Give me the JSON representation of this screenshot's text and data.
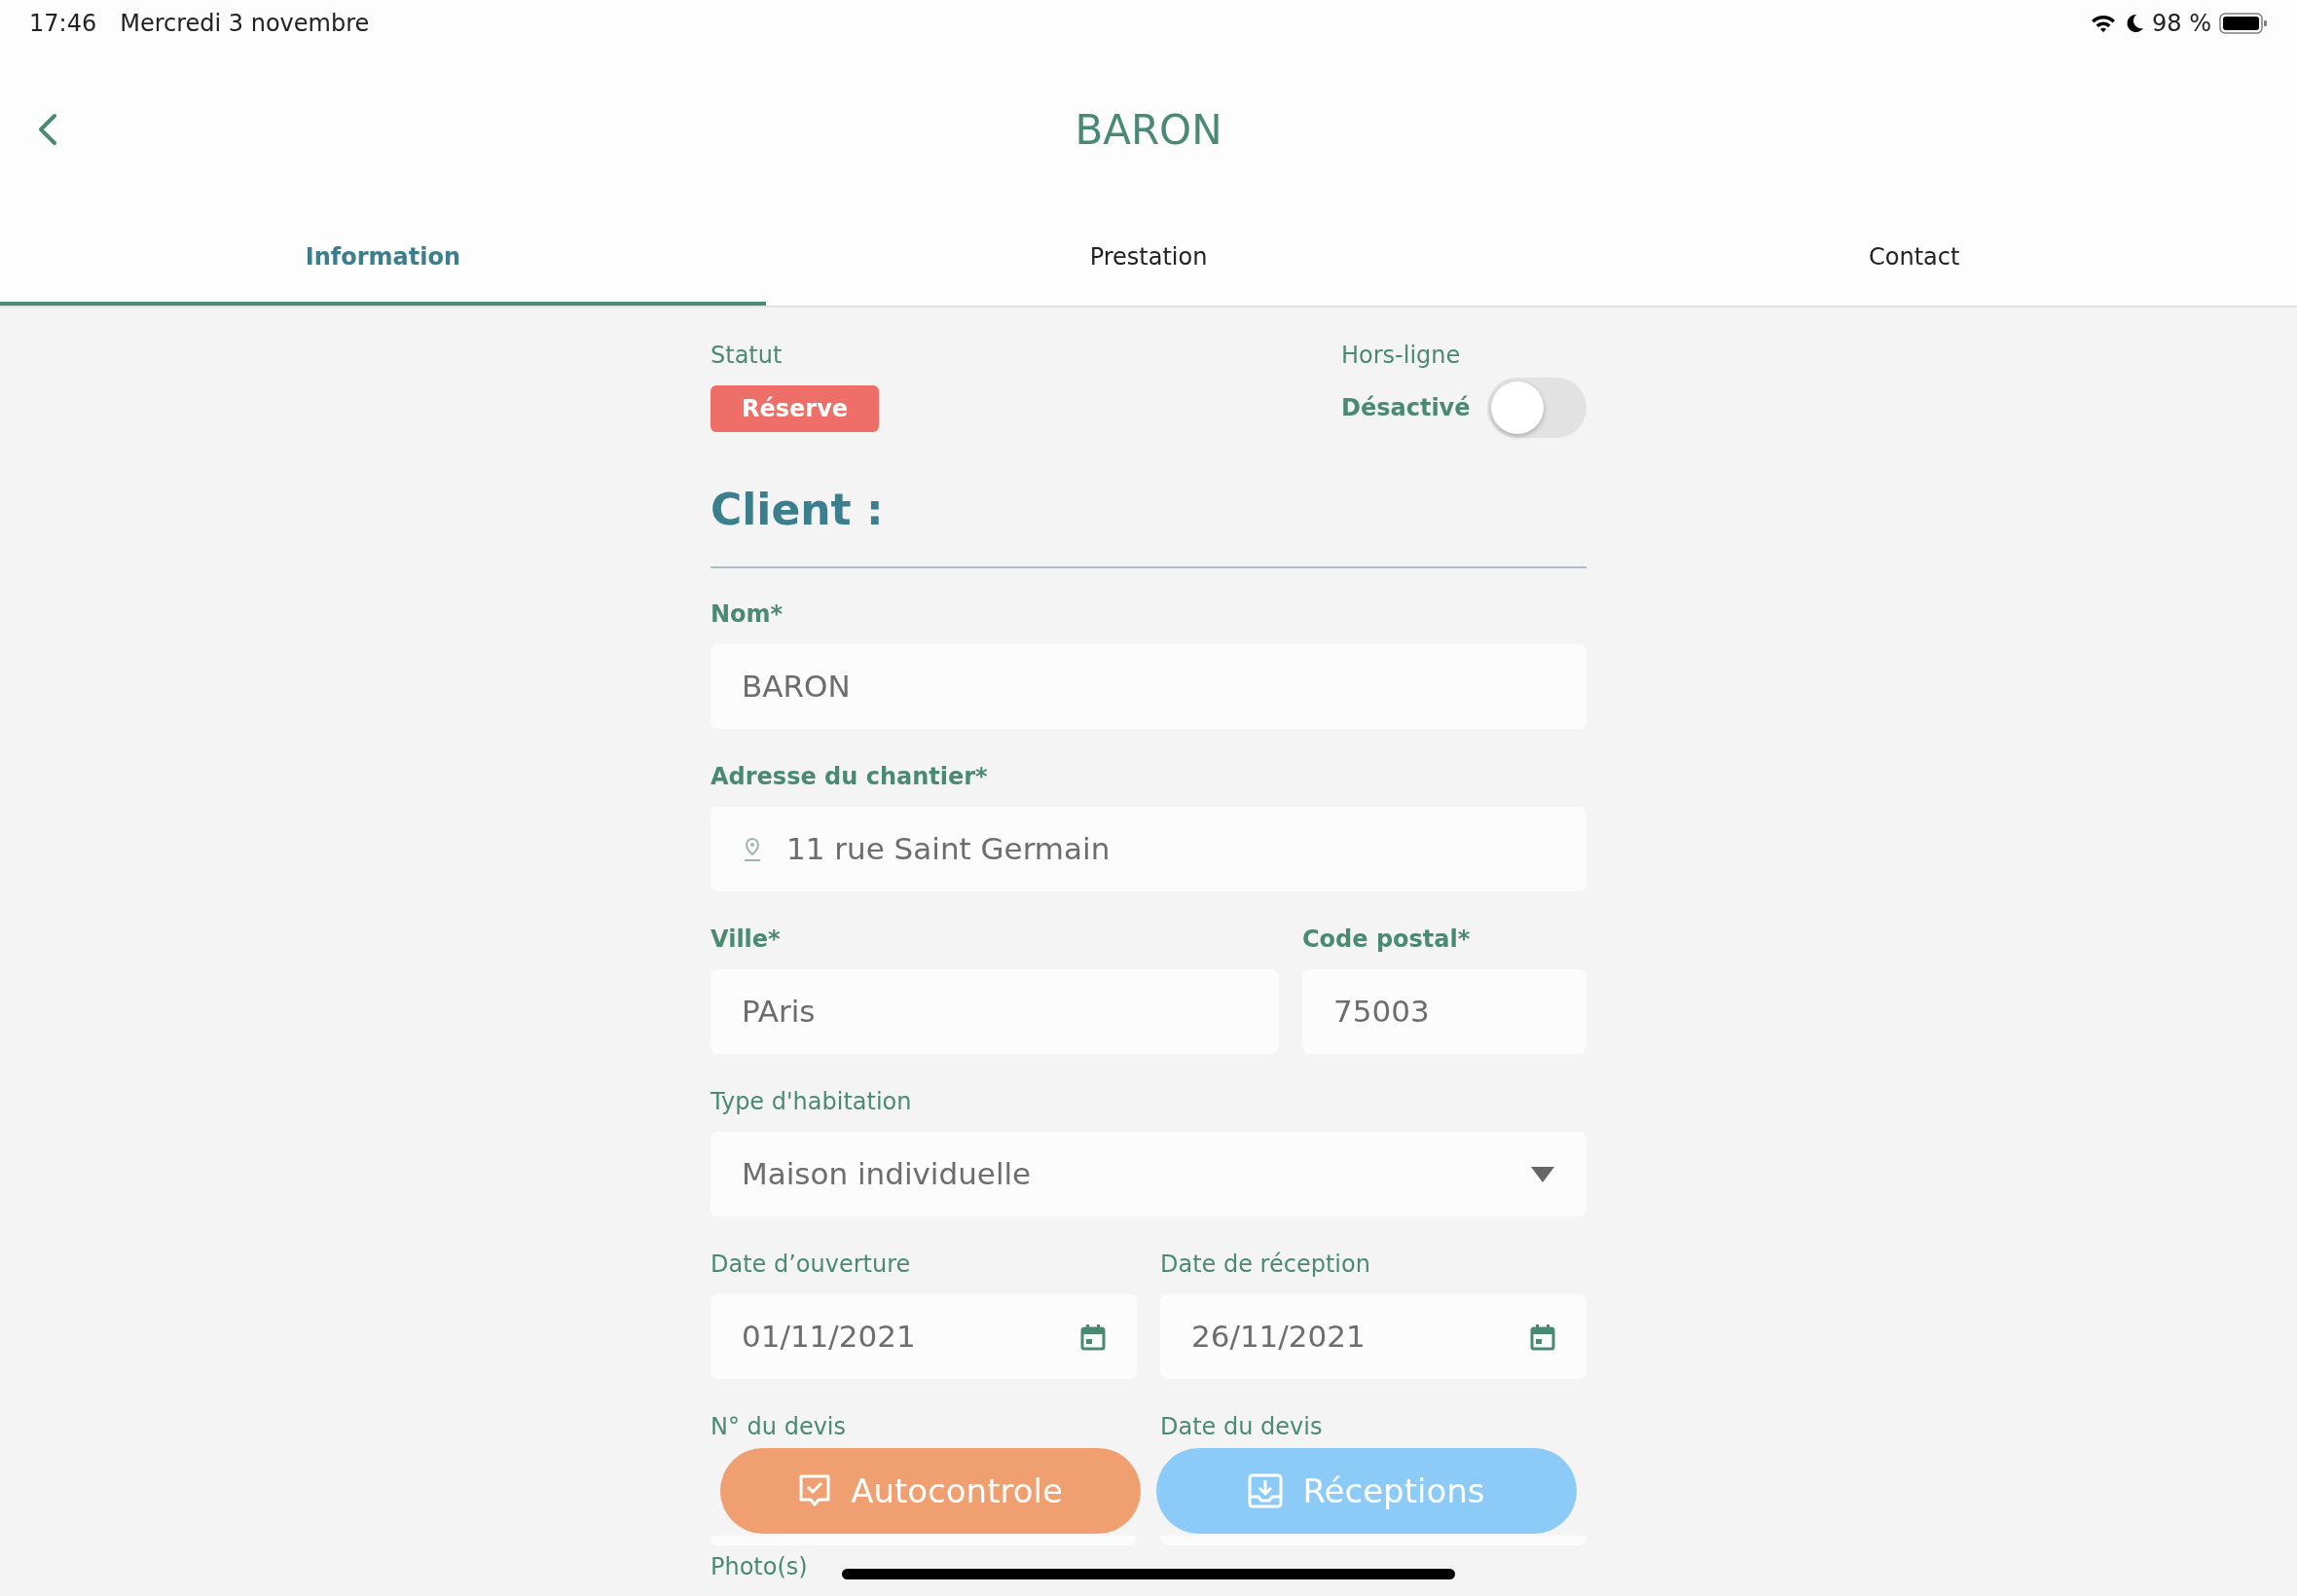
{
  "status_bar": {
    "time": "17:46",
    "date": "Mercredi 3 novembre",
    "battery": "98 %"
  },
  "header": {
    "title": "BARON"
  },
  "tabs": [
    {
      "label": "Information",
      "selected": true
    },
    {
      "label": "Prestation",
      "selected": false
    },
    {
      "label": "Contact",
      "selected": false
    }
  ],
  "status": {
    "label": "Statut",
    "value": "Réserve"
  },
  "offline": {
    "label": "Hors-ligne",
    "state_text": "Désactivé",
    "on": false
  },
  "section_title": "Client :",
  "rows": [
    {
      "fields": [
        {
          "kind": "text",
          "label": "Nom*",
          "required": true,
          "value": "BARON"
        }
      ]
    },
    {
      "fields": [
        {
          "kind": "address",
          "label": "Adresse du chantier*",
          "required": true,
          "value": "11 rue Saint Germain"
        }
      ]
    },
    {
      "fields": [
        {
          "kind": "text",
          "label": "Ville*",
          "required": true,
          "value": "PAris"
        },
        {
          "kind": "text",
          "label": "Code postal*",
          "required": true,
          "value": "75003"
        }
      ]
    },
    {
      "fields": [
        {
          "kind": "select",
          "label": "Type d'habitation",
          "required": false,
          "value": "Maison individuelle"
        }
      ]
    },
    {
      "fields": [
        {
          "kind": "date",
          "label": "Date d’ouverture",
          "required": false,
          "value": "01/11/2021"
        },
        {
          "kind": "date",
          "label": "Date de réception",
          "required": false,
          "value": "26/11/2021"
        }
      ]
    },
    {
      "fields": [
        {
          "kind": "empty",
          "label": "N° du devis",
          "required": false
        },
        {
          "kind": "empty",
          "label": "Date du devis",
          "required": false
        }
      ]
    }
  ],
  "photos_label": "Photo(s)",
  "actions": [
    {
      "kind": "checklist",
      "label": "Autocontrole"
    },
    {
      "kind": "download",
      "label": "Réceptions"
    }
  ]
}
